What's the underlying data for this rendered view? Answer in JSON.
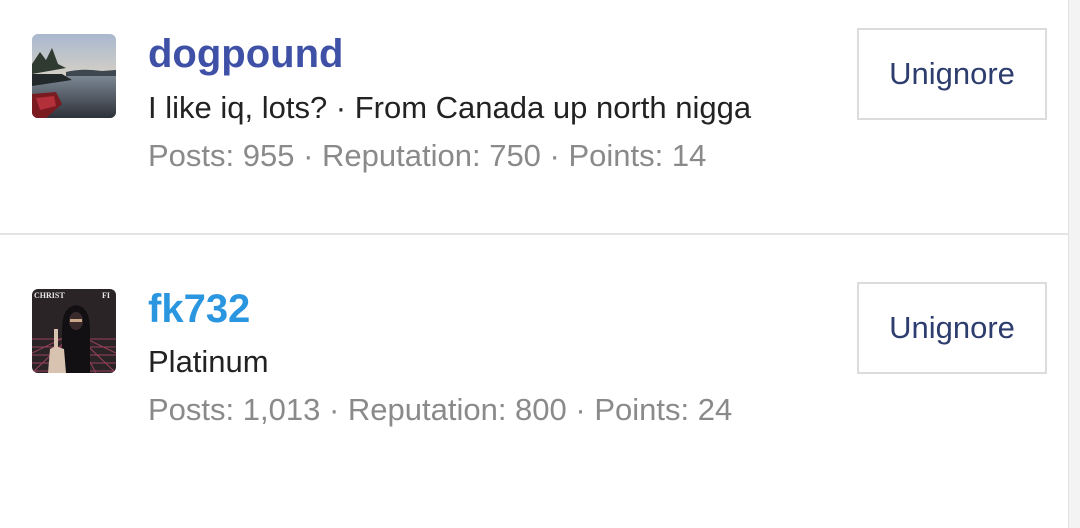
{
  "colors": {
    "username_dogpound": "#3f51a6",
    "username_fk732": "#2b96e0",
    "button_text": "#2d3e6e",
    "stats_text": "#8a8a8a"
  },
  "users": [
    {
      "name": "dogpound",
      "title": "I like iq, lots? · From Canada up north nigga",
      "stats": "Posts: 955 · Reputation: 750 · Points: 14",
      "button": "Unignore",
      "avatar_icon": "lake-landscape-photo"
    },
    {
      "name": "fk732",
      "title": "Platinum",
      "stats": "Posts: 1,013 · Reputation: 800 · Points: 24",
      "button": "Unignore",
      "avatar_icon": "hooded-figure-pointing-photo",
      "avatar_text_left": "CHRIST",
      "avatar_text_right": "FI"
    }
  ]
}
